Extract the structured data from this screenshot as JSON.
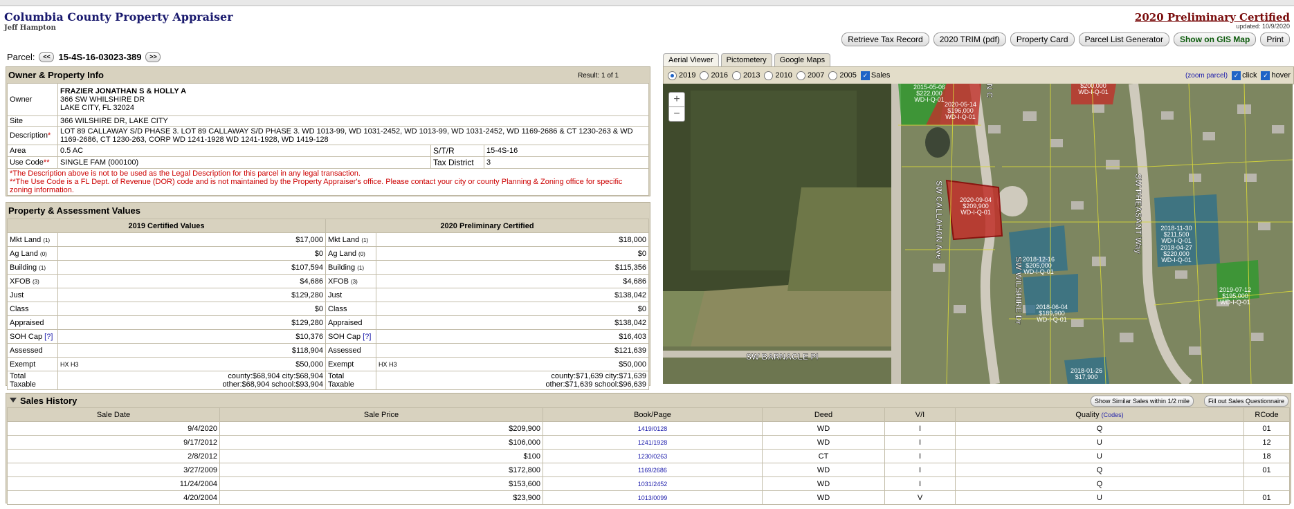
{
  "header": {
    "title": "Columbia County Property Appraiser",
    "subtitle": "Jeff Hampton",
    "prelim": "2020 Preliminary Certified",
    "updated": "updated: 10/9/2020"
  },
  "buttons": [
    "Retrieve Tax Record",
    "2020 TRIM (pdf)",
    "Property Card",
    "Parcel List Generator",
    "Show on GIS Map",
    "Print"
  ],
  "parcel": {
    "label": "Parcel:",
    "prev": "<<",
    "number": "15-4S-16-03023-389",
    "next": ">>"
  },
  "owner": {
    "heading": "Owner & Property Info",
    "result": "Result: 1 of 1",
    "owner_label": "Owner",
    "owner_name": "FRAZIER JONATHAN S & HOLLY A",
    "owner_addr1": "366 SW WHILSHIRE DR",
    "owner_addr2": "LAKE CITY, FL 32024",
    "site_label": "Site",
    "site": "366 WILSHIRE DR, LAKE CITY",
    "desc_label": "Description",
    "desc": "LOT 89 CALLAWAY S/D PHASE 3. LOT 89 CALLAWAY S/D PHASE 3. WD 1013-99, WD 1031-2452, WD 1013-99, WD 1031-2452, WD 1169-2686 & CT 1230-263 & WD 1169-2686, CT 1230-263, CORP WD 1241-1928 WD 1241-1928, WD 1419-128",
    "area_label": "Area",
    "area": "0.5 AC",
    "str_label": "S/T/R",
    "str": "15-4S-16",
    "use_label": "Use Code",
    "use": "SINGLE FAM (000100)",
    "taxdist_label": "Tax District",
    "taxdist": "3",
    "note1": "*The Description above is not to be used as the Legal Description for this parcel in any legal transaction.",
    "note2": "**The Use Code is a FL Dept. of Revenue (DOR) code and is not maintained by the Property Appraiser's office. Please contact your city or county Planning & Zoning office for specific zoning information."
  },
  "values": {
    "heading": "Property & Assessment Values",
    "col1": "2019 Certified Values",
    "col2": "2020 Preliminary Certified",
    "rows": [
      {
        "label": "Mkt Land",
        "sub": "(1)",
        "v1": "$17,000",
        "v2": "$18,000"
      },
      {
        "label": "Ag Land",
        "sub": "(0)",
        "v1": "$0",
        "v2": "$0"
      },
      {
        "label": "Building",
        "sub": "(1)",
        "v1": "$107,594",
        "v2": "$115,356"
      },
      {
        "label": "XFOB",
        "sub": "(3)",
        "v1": "$4,686",
        "v2": "$4,686"
      },
      {
        "label": "Just",
        "sub": "",
        "v1": "$129,280",
        "v2": "$138,042"
      },
      {
        "label": "Class",
        "sub": "",
        "v1": "$0",
        "v2": "$0"
      },
      {
        "label": "Appraised",
        "sub": "",
        "v1": "$129,280",
        "v2": "$138,042"
      },
      {
        "label": "SOH Cap",
        "sub": "[?]",
        "v1": "$10,376",
        "v2": "$16,403"
      },
      {
        "label": "Assessed",
        "sub": "",
        "v1": "$118,904",
        "v2": "$121,639"
      }
    ],
    "exempt_label": "Exempt",
    "exempt_code": "HX H3",
    "exempt1": "$50,000",
    "exempt2": "$50,000",
    "taxable_label1": "Total",
    "taxable_label2": "Taxable",
    "tax1_line1": "county:$68,904 city:$68,904",
    "tax1_line2": "other:$68,904 school:$93,904",
    "tax2_line1": "county:$71,639 city:$71,639",
    "tax2_line2": "other:$71,639 school:$96,639"
  },
  "map": {
    "tabs": [
      "Aerial Viewer",
      "Pictometery",
      "Google Maps"
    ],
    "years": [
      "2019",
      "2016",
      "2013",
      "2010",
      "2007",
      "2005"
    ],
    "sales_label": "Sales",
    "zoom_parcel": "(zoom parcel)",
    "click": "click",
    "hover": "hover",
    "zoom_in": "+",
    "zoom_out": "−",
    "roads": [
      "SW CALLAHAN Ave",
      "SW WILSHIRE Dr",
      "SW PHEASANT Way",
      "SW BARNACLE Pl",
      "N C"
    ],
    "tags": [
      {
        "l1": "2015-05-06",
        "l2": "$222,000",
        "l3": "WD-I-Q-01"
      },
      {
        "l1": "2020-05-14",
        "l2": "$196,000",
        "l3": "WD-I-Q-01"
      },
      {
        "l1": "$200,000",
        "l2": "WD-I-Q-01",
        "l3": ""
      },
      {
        "l1": "2020-09-04",
        "l2": "$209,900",
        "l3": "WD-I-Q-01"
      },
      {
        "l1": "2018-12-16",
        "l2": "$205,000",
        "l3": "WD-I-Q-01"
      },
      {
        "l1": "2018-11-30",
        "l2": "$211,500",
        "l3": "WD-I-Q-01"
      },
      {
        "l1": "2018-04-27",
        "l2": "$220,000",
        "l3": "WD-I-Q-01"
      },
      {
        "l1": "2018-06-04",
        "l2": "$189,900",
        "l3": "WD-I-Q-01"
      },
      {
        "l1": "2019-07-12",
        "l2": "$195,000",
        "l3": "WD-I-Q-01"
      },
      {
        "l1": "2018-01-26",
        "l2": "$17,900",
        "l3": ""
      }
    ]
  },
  "sales": {
    "heading": "Sales History",
    "btn1": "Show Similar Sales within 1/2 mile",
    "btn2": "Fill out Sales Questionnaire",
    "headers": [
      "Sale Date",
      "Sale Price",
      "Book/Page",
      "Deed",
      "V/I",
      "Quality",
      "RCode"
    ],
    "codes": "(Codes)",
    "rows": [
      [
        "9/4/2020",
        "$209,900",
        "1419/0128",
        "WD",
        "I",
        "Q",
        "01"
      ],
      [
        "9/17/2012",
        "$106,000",
        "1241/1928",
        "WD",
        "I",
        "U",
        "12"
      ],
      [
        "2/8/2012",
        "$100",
        "1230/0263",
        "CT",
        "I",
        "U",
        "18"
      ],
      [
        "3/27/2009",
        "$172,800",
        "1169/2686",
        "WD",
        "I",
        "Q",
        "01"
      ],
      [
        "11/24/2004",
        "$153,600",
        "1031/2452",
        "WD",
        "I",
        "Q",
        ""
      ],
      [
        "4/20/2004",
        "$23,900",
        "1013/0099",
        "WD",
        "V",
        "U",
        "01"
      ]
    ]
  },
  "colors": {
    "title": "#1a1a6e",
    "prelim": "#7a0d0d",
    "panel": "#d8d2bf",
    "gis": "#0b5a0b",
    "link": "#1a1aaa"
  }
}
